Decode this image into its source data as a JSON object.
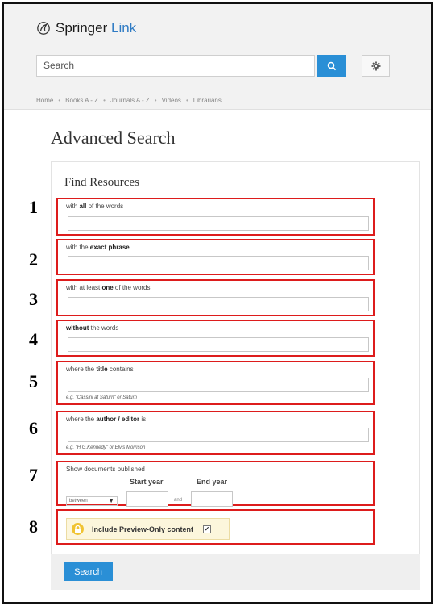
{
  "brand": {
    "name_bold": "Springer",
    "name_light": "Link"
  },
  "search": {
    "placeholder": "Search"
  },
  "nav": [
    "Home",
    "Books A - Z",
    "Journals A - Z",
    "Videos",
    "Librarians"
  ],
  "nav_separator": "•",
  "page_title": "Advanced Search",
  "section_title": "Find Resources",
  "fields": [
    {
      "number": "1",
      "label_pre": "with ",
      "label_bold": "all",
      "label_post": " of the words",
      "hint": ""
    },
    {
      "number": "2",
      "label_pre": "with the ",
      "label_bold": "exact phrase",
      "label_post": "",
      "hint": ""
    },
    {
      "number": "3",
      "label_pre": "with at least ",
      "label_bold": "one",
      "label_post": " of the words",
      "hint": ""
    },
    {
      "number": "4",
      "label_pre": "",
      "label_bold": "without",
      "label_post": " the words",
      "hint": ""
    },
    {
      "number": "5",
      "label_pre": "where the ",
      "label_bold": "title",
      "label_post": " contains",
      "hint": "e.g. \"Cassini at Saturn\" or Saturn"
    },
    {
      "number": "6",
      "label_pre": "where the ",
      "label_bold": "author / editor",
      "label_post": " is",
      "hint": "e.g. \"H.G.Kennedy\" or Elvis Morrison"
    }
  ],
  "date_filter": {
    "number": "7",
    "label": "Show documents published",
    "select_value": "between",
    "start_label": "Start year",
    "end_label": "End year",
    "and_text": "and"
  },
  "preview": {
    "number": "8",
    "label": "Include Preview-Only content",
    "checked": true,
    "check_glyph": "✔"
  },
  "submit_label": "Search",
  "colors": {
    "accent": "#2a8fd6",
    "highlight_border": "#dd1c1c",
    "preview_bg": "#fcf6dc"
  }
}
